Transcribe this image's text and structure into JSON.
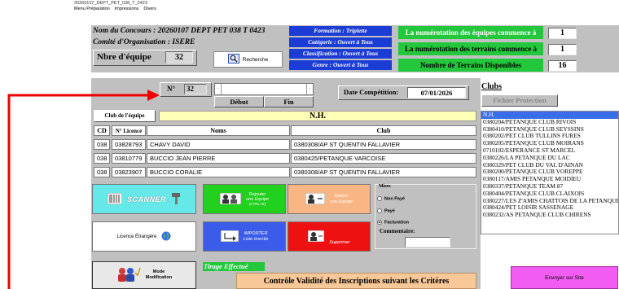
{
  "window": {
    "title": "20260107_DEPT_PET_038_T_0423"
  },
  "menu": [
    "Menu Préparation",
    "Impressions",
    "Divers"
  ],
  "concours": {
    "nom_label": "Nom du Concours : 20260107 DEPT PET 038 T 0423",
    "comite_label": "Comité d'Organisation : ISERE",
    "nbre_label": "Nbre d'équipe",
    "nbre_value": "32",
    "recherche_label": "Recherche"
  },
  "info_blue": [
    "Formation : Triplette",
    "Catégorie : Ouvert à Tous",
    "Classification : Ouvert à Tous",
    "Genre : Ouvert à Tous"
  ],
  "numerotation": {
    "equipes_label": "La numérotation des équipes commence à",
    "equipes_value": "1",
    "terrains_label": "La numérotation des terrains commence à",
    "terrains_value": "1",
    "dispo_label": "Nombre de Terrains Disponibles",
    "dispo_value": "16"
  },
  "nav": {
    "numero_label": "N°",
    "numero_value": "32",
    "debut_label": "Début",
    "fin_label": "Fin",
    "date_label": "Date Compétition:",
    "date_value": "07/01/2026"
  },
  "club_equipe": {
    "label": "Club de l'équipe",
    "value": "N.H."
  },
  "table": {
    "headers": {
      "cd": "CD",
      "licence": "N° Licence",
      "noms": "Noms",
      "club": "Club"
    },
    "rows": [
      {
        "cd": "038",
        "licence": "03828793",
        "nom": "CHAVY DAVID",
        "club": "0380308/AP ST QUENTIN FALLAVIER"
      },
      {
        "cd": "038",
        "licence": "03810779",
        "nom": "BUCCIO JEAN PIERRE",
        "club": "0380425/PETANQUE VARCOISE"
      },
      {
        "cd": "038",
        "licence": "03823907",
        "nom": "BUCCIO CORALIE",
        "club": "0380308/AP ST QUENTIN FALLAVIER"
      }
    ]
  },
  "buttons": {
    "scanner": "SCANNER",
    "rajouter_line1": "Rajouter",
    "rajouter_line2": "une Equipe",
    "rajouter_line3": "(CTRL+E)",
    "inserer_line1": "Insérer",
    "inserer_line2": "une Equipe",
    "licence_etrangere": "Licence Étrangère",
    "importer_line1": "IMPORTER",
    "importer_line2": "Liste Inscrits",
    "supprimer": "Supprimer",
    "mode_line1": "Mode",
    "mode_line2": "Modification",
    "envoyer": "Envoyer sur Site",
    "controle": "Contrôle Validité des Inscriptions suivant les Critères",
    "tirage": "Tirage Effectué"
  },
  "mises": {
    "title": "Mises",
    "options": [
      "Non Payé",
      "Payé",
      "Facturation"
    ],
    "selected": "Facturation",
    "commentaire_label": "Commentaire:"
  },
  "clubs": {
    "title": "Clubs",
    "fichier_protection": "Fichier Protection",
    "selected": "N.H.",
    "items": [
      "N.H.",
      "0380204/PETANQUE CLUB RIVOIS",
      "0380410/PETANQUE CLUB SEYSSINS",
      "0380202/PET CLUB TULLINS FURES",
      "0380205/PETANQUE CLUB MOIRANS",
      "0710102/ESPERANCE  ST MARCEL",
      "0380226/LA PETANQUE DU LAC",
      "0380329/PET CLUB DU VAL D'AINAN",
      "0380200/PETANQUE CLUB VOREPPE",
      "0380117/AMIS PETANQUE MOIDIEU",
      "0380337/PETANQUE  TEAM 87",
      "0380404/PETANQUE CLUB CLAIXOIS",
      "0380227/LES Z'AMIS CHATTOIS DE LA PETANQUE",
      "0380424/PET LOISIR SASSENAGE",
      "0380232/AS PETANQUE CLUB CHIRENS"
    ]
  },
  "colors": {
    "panel": "#c0c0c0",
    "blue": "#1c3cd6",
    "green": "#22c73c",
    "scanner": "#66e8e8",
    "rajouter": "#22d01e",
    "inserer": "#f8b684",
    "supprimer": "#ee1111",
    "envoyer": "#f25cf2",
    "controle": "#f8c898",
    "club_value": "#ffffb8",
    "selection": "#3a6ee8",
    "arrow": "#ee0000"
  }
}
